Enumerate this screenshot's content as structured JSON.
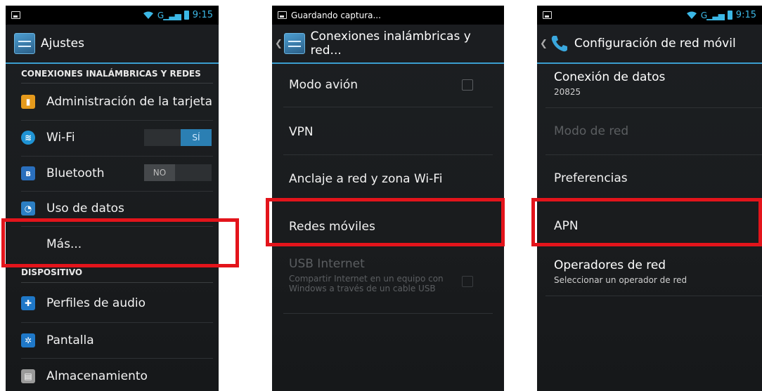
{
  "panel1": {
    "status_clock": "9:15",
    "title": "Ajustes",
    "category1": "CONEXIONES INALÁMBRICAS Y REDES",
    "items": [
      {
        "label": "Administración de la tarjeta",
        "icon": "sim-card-icon"
      },
      {
        "label": "Wi-Fi",
        "icon": "wifi-icon"
      },
      {
        "label": "Bluetooth",
        "icon": "bluetooth-icon"
      },
      {
        "label": "Uso de datos",
        "icon": "data-usage-icon"
      },
      {
        "label": "Más..."
      }
    ],
    "wifi_toggle": "SÍ",
    "bt_toggle": "NO",
    "category2": "DISPOSITIVO",
    "items2": [
      {
        "label": "Perfiles de audio",
        "icon": "audio-profiles-icon"
      },
      {
        "label": "Pantalla",
        "icon": "display-icon"
      },
      {
        "label": "Almacenamiento",
        "icon": "storage-icon"
      }
    ]
  },
  "panel2": {
    "status_text": "Guardando captura...",
    "title": "Conexiones inalámbricas y red...",
    "items": [
      {
        "label": "Modo avión"
      },
      {
        "label": "VPN"
      },
      {
        "label": "Anclaje a red y zona Wi-Fi"
      },
      {
        "label": "Redes móviles"
      },
      {
        "label": "USB Internet",
        "summary": "Compartir Internet en un equipo con Windows a través de un cable USB"
      }
    ]
  },
  "panel3": {
    "status_clock": "9:15",
    "title": "Configuración de red móvil",
    "items": [
      {
        "label": "Conexión de datos",
        "summary": "20825"
      },
      {
        "label": "Modo de red"
      },
      {
        "label": "Preferencias"
      },
      {
        "label": "APN"
      },
      {
        "label": "Operadores de red",
        "summary": "Seleccionar un operador de red"
      }
    ]
  },
  "colors": {
    "highlight": "#e3141b",
    "accent": "#3cb8e6",
    "toggle_on": "#2b7fb3"
  }
}
